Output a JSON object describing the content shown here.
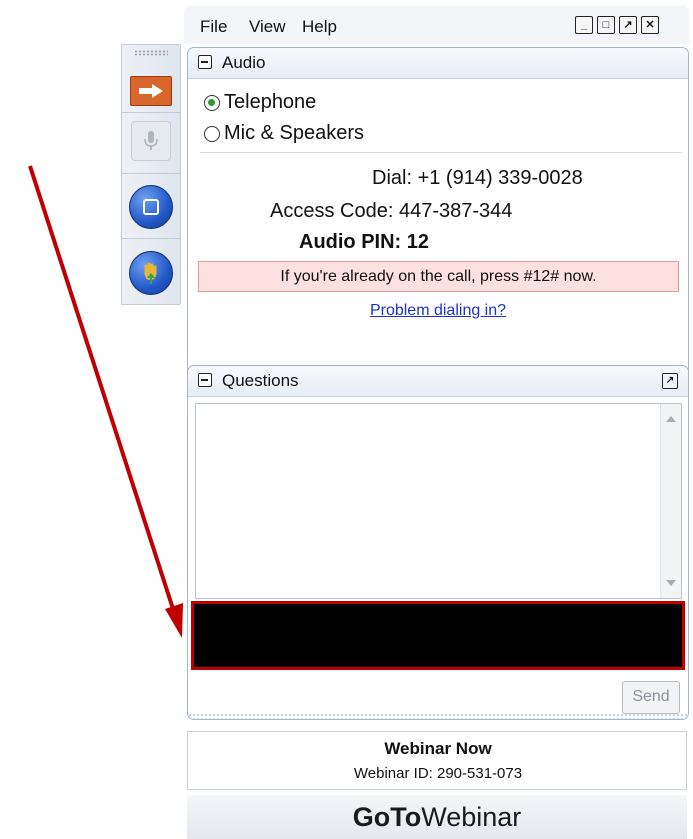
{
  "menu": {
    "file": "File",
    "view": "View",
    "help": "Help"
  },
  "window_controls": [
    "minimize-icon",
    "restore-icon",
    "popout-icon",
    "close-icon"
  ],
  "toolbar": {
    "icons": [
      "grab-handle-icon",
      "show-hide-arrow-icon",
      "microphone-icon",
      "screen-icon",
      "raise-hand-icon"
    ],
    "accent_color": "#d9662a"
  },
  "audio": {
    "title": "Audio",
    "options": [
      {
        "label": "Telephone",
        "selected": true
      },
      {
        "label": "Mic & Speakers",
        "selected": false
      }
    ],
    "dial": "Dial: +1 (914) 339-0028",
    "access_code": "Access Code: 447-387-344",
    "pin": "Audio PIN: 12",
    "note": "If you're already on the call, press #12# now.",
    "link": "Problem dialing in?"
  },
  "questions": {
    "title": "Questions",
    "send_label": "Send"
  },
  "footer": {
    "title": "Webinar Now",
    "webinar_id": "Webinar ID: 290-531-073"
  },
  "brand": {
    "bold": "GoTo",
    "regular": "Webinar"
  },
  "colors": {
    "panel_border": "#9fb5d6",
    "note_bg": "#fde0e0",
    "annotation_red": "#c00000",
    "link": "#1a33cc"
  }
}
